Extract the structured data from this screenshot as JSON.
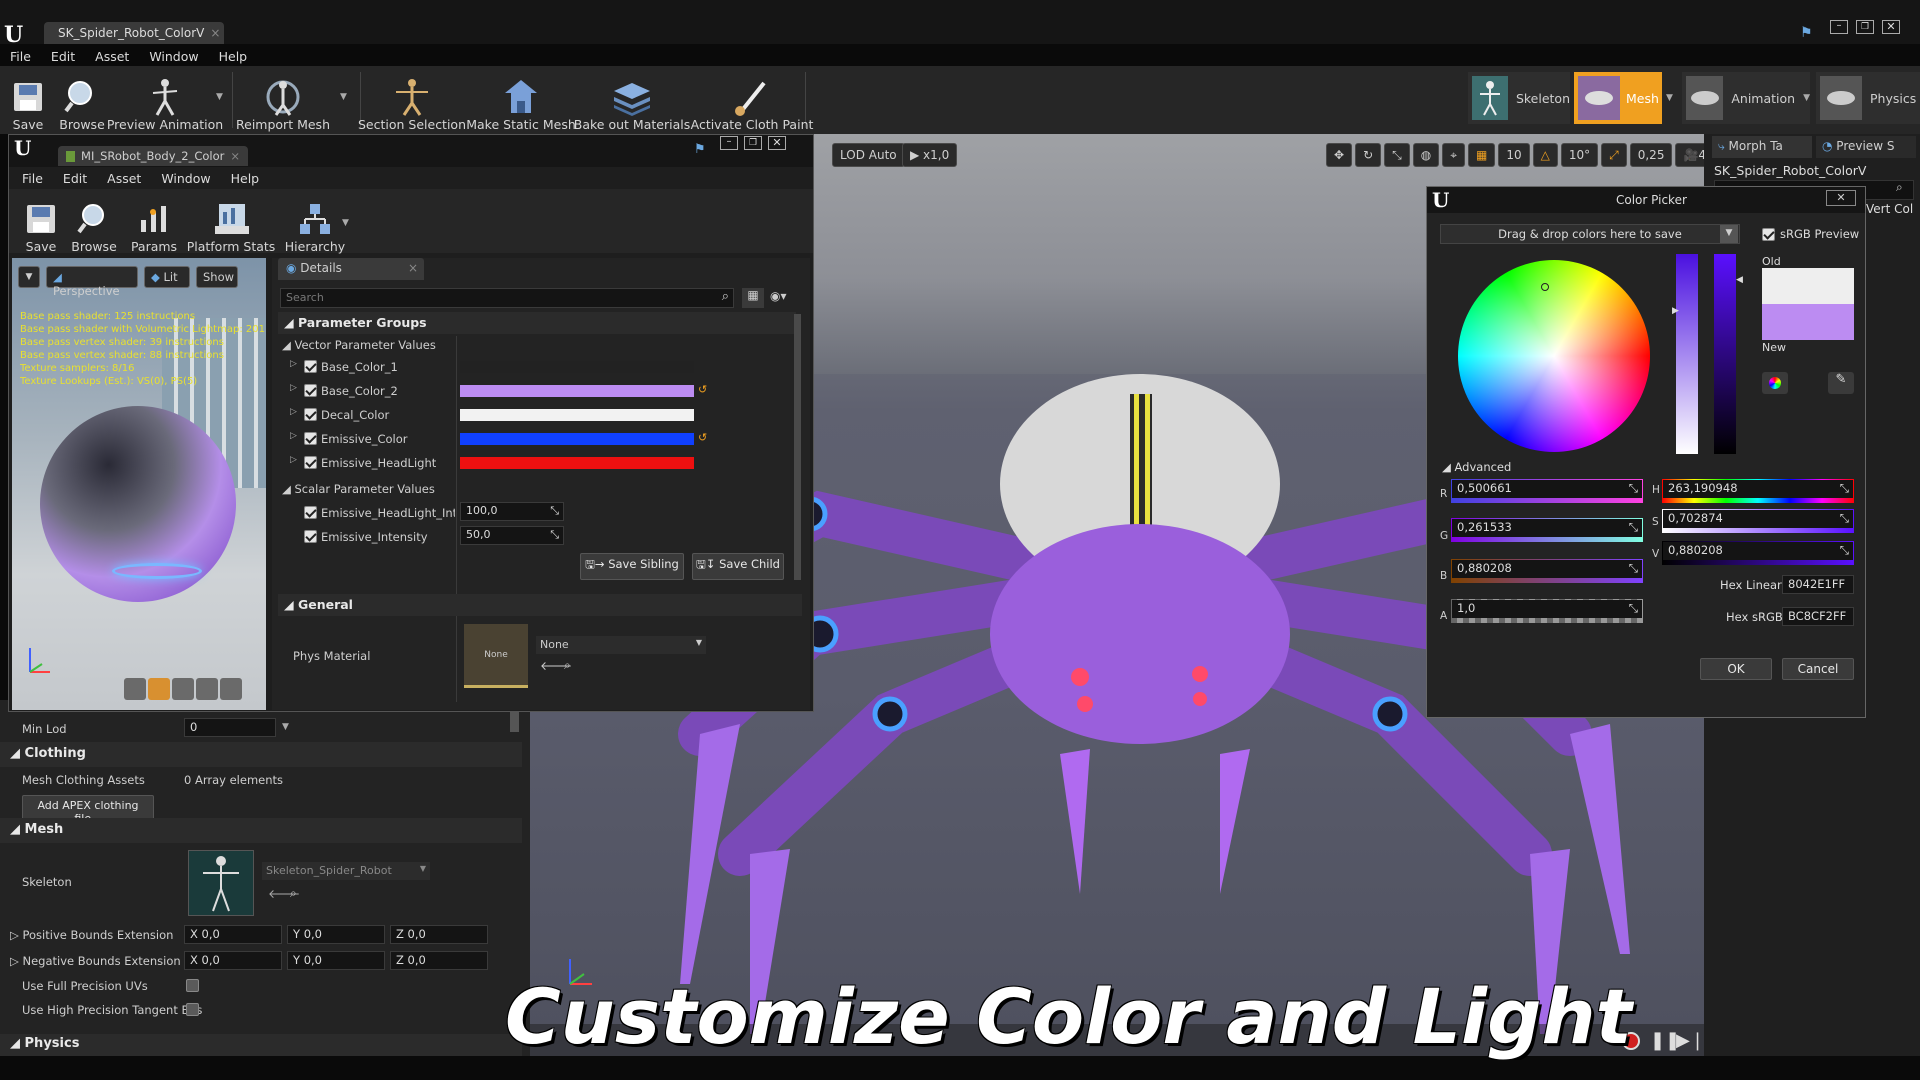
{
  "window": {
    "tab_title": "SK_Spider_Robot_ColorV"
  },
  "menubar": [
    "File",
    "Edit",
    "Asset",
    "Window",
    "Help"
  ],
  "main_toolbar": [
    {
      "label": "Save",
      "icon": "save-icon"
    },
    {
      "label": "Browse",
      "icon": "browse-icon"
    },
    {
      "label": "Preview Animation",
      "icon": "preview-animation-icon"
    },
    {
      "label": "Reimport Mesh",
      "icon": "reimport-icon"
    },
    {
      "label": "Section Selection",
      "icon": "section-selection-icon"
    },
    {
      "label": "Make Static Mesh",
      "icon": "make-static-mesh-icon"
    },
    {
      "label": "Bake out Materials",
      "icon": "bake-materials-icon"
    },
    {
      "label": "Activate Cloth Paint",
      "icon": "cloth-paint-icon"
    }
  ],
  "mode_tabs": [
    {
      "label": "Skeleton"
    },
    {
      "label": "Mesh",
      "active": true
    },
    {
      "label": "Animation"
    },
    {
      "label": "Physics"
    }
  ],
  "right_panel": {
    "tabs": [
      "Morph Ta",
      "Preview S"
    ],
    "asset_name": "SK_Spider_Robot_ColorV",
    "vert_label": "Vert Col"
  },
  "viewport": {
    "lod": "LOD Auto",
    "speed": "x1,0",
    "grid_snap": "10",
    "rot_snap": "10°",
    "scale_snap": "0,25",
    "cam_speed": "4"
  },
  "material_editor": {
    "tab_title": "MI_SRobot_Body_2_Color",
    "menubar": [
      "File",
      "Edit",
      "Asset",
      "Window",
      "Help"
    ],
    "toolbar": [
      {
        "label": "Save"
      },
      {
        "label": "Browse"
      },
      {
        "label": "Params"
      },
      {
        "label": "Platform Stats"
      },
      {
        "label": "Hierarchy"
      }
    ],
    "viewport_buttons": {
      "perspective": "Perspective",
      "lit": "Lit",
      "show": "Show"
    },
    "stats": [
      "Base pass shader: 125 instructions",
      "Base pass shader with Volumetric Lightmap: 201",
      "Base pass vertex shader: 39 instructions",
      "Base pass vertex shader: 88 instructions",
      "Texture samplers: 8/16",
      "Texture Lookups (Est.): VS(0), PS(5)"
    ],
    "details_tab": "Details",
    "search_placeholder": "Search",
    "parameter_groups": "Parameter Groups",
    "vector_header": "Vector Parameter Values",
    "vectors": [
      {
        "name": "Base_Color_1",
        "color": "#222222",
        "reset": false
      },
      {
        "name": "Base_Color_2",
        "color": "#bc8cf2",
        "reset": true
      },
      {
        "name": "Decal_Color",
        "color": "#f2f2f2",
        "reset": false
      },
      {
        "name": "Emissive_Color",
        "color": "#1040ff",
        "reset": true
      },
      {
        "name": "Emissive_HeadLight",
        "color": "#ee1010",
        "reset": false
      }
    ],
    "scalar_header": "Scalar Parameter Values",
    "scalars": [
      {
        "name": "Emissive_HeadLight_Intens",
        "value": "100,0"
      },
      {
        "name": "Emissive_Intensity",
        "value": "50,0"
      }
    ],
    "save_sibling": "Save Sibling",
    "save_child": "Save Child",
    "general": "General",
    "phys_material": "Phys Material",
    "phys_thumb": "None",
    "phys_value": "None"
  },
  "left_details": {
    "min_lod": {
      "label": "Min Lod",
      "value": "0"
    },
    "clothing": "Clothing",
    "mesh_clothing_assets": {
      "label": "Mesh Clothing Assets",
      "value": "0 Array elements"
    },
    "add_apex": "Add APEX clothing file...",
    "mesh": "Mesh",
    "skeleton": {
      "label": "Skeleton",
      "value": "Skeleton_Spider_Robot"
    },
    "positive_bounds": {
      "label": "Positive Bounds Extension",
      "x": "0,0",
      "y": "0,0",
      "z": "0,0"
    },
    "negative_bounds": {
      "label": "Negative Bounds Extension",
      "x": "0,0",
      "y": "0,0",
      "z": "0,0"
    },
    "full_precision": "Use Full Precision UVs",
    "high_precision": "Use High Precision Tangent Bas",
    "physics": "Physics",
    "axis": {
      "x": "X",
      "y": "Y",
      "z": "Z"
    }
  },
  "color_picker": {
    "title": "Color Picker",
    "drop_hint": "Drag & drop colors here to save",
    "srgb_preview": "sRGB Preview",
    "old_label": "Old",
    "new_label": "New",
    "old_color": "#eeeeee",
    "new_color": "#bc8cf2",
    "advanced": "Advanced",
    "r": {
      "label": "R",
      "value": "0,500661"
    },
    "g": {
      "label": "G",
      "value": "0,261533"
    },
    "b": {
      "label": "B",
      "value": "0,880208"
    },
    "a": {
      "label": "A",
      "value": "1,0"
    },
    "h": {
      "label": "H",
      "value": "263,190948"
    },
    "s": {
      "label": "S",
      "value": "0,702874"
    },
    "v": {
      "label": "V",
      "value": "0,880208"
    },
    "hex_linear": {
      "label": "Hex Linear",
      "value": "8042E1FF"
    },
    "hex_srgb": {
      "label": "Hex sRGB",
      "value": "BC8CF2FF"
    },
    "ok": "OK",
    "cancel": "Cancel"
  },
  "caption": "Customize Color and Light"
}
